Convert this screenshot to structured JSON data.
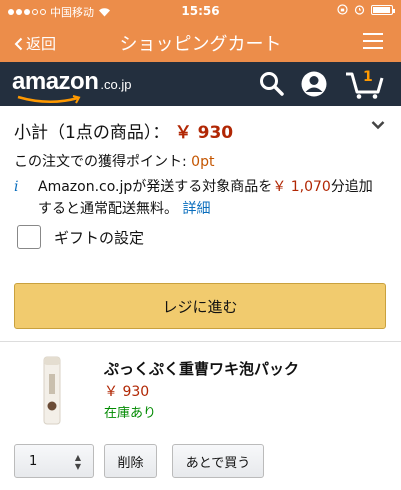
{
  "status_bar": {
    "carrier": "中国移动",
    "time": "15:56"
  },
  "nav": {
    "back_label": "返回",
    "title": "ショッピングカート"
  },
  "header": {
    "logo_main": "amazon",
    "logo_tld": ".co.jp",
    "cart_count": "1",
    "colors": {
      "bar": "#232f3e",
      "accent": "#ff9900"
    }
  },
  "summary": {
    "subtotal_label": "小計（1点の商品）：",
    "subtotal_price": "￥ 930",
    "points_label": "この注文での獲得ポイント: ",
    "points_value": "0pt",
    "shipping_prefix": "Amazon.co.jpが発送する対象商品を",
    "shipping_amount": "￥ 1,070",
    "shipping_suffix": "分追加すると通常配送無料。",
    "details_link": "詳細",
    "gift_label": "ギフトの設定",
    "checkout_label": "レジに進む"
  },
  "item": {
    "title": "ぷっくぷく重曹ワキ泡パック",
    "price": "￥ 930",
    "stock": "在庫あり",
    "quantity": "1",
    "delete_label": "削除",
    "save_later_label": "あとで買う"
  }
}
